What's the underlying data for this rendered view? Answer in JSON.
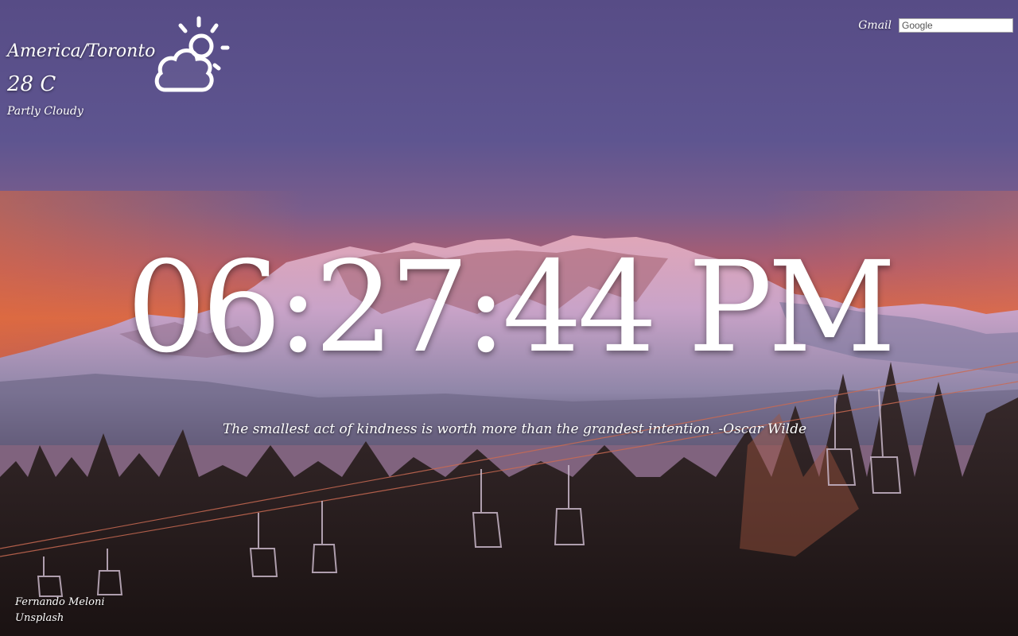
{
  "weather": {
    "location": "America/Toronto",
    "temperature": "28 C",
    "condition": "Partly Cloudy",
    "icon": "partly-cloudy-icon"
  },
  "top_links": {
    "gmail": "Gmail",
    "search_placeholder": "Google"
  },
  "clock": {
    "time": "06:27:44 PM"
  },
  "quote": {
    "text": "The smallest act of kindness is worth more than the grandest intention. -Oscar Wilde"
  },
  "photo_credit": {
    "photographer": "Fernando Meloni",
    "source": "Unsplash"
  },
  "colors": {
    "sky_top": "#5a4e87",
    "sky_glow": "#d9654a",
    "text": "#ffffff"
  }
}
